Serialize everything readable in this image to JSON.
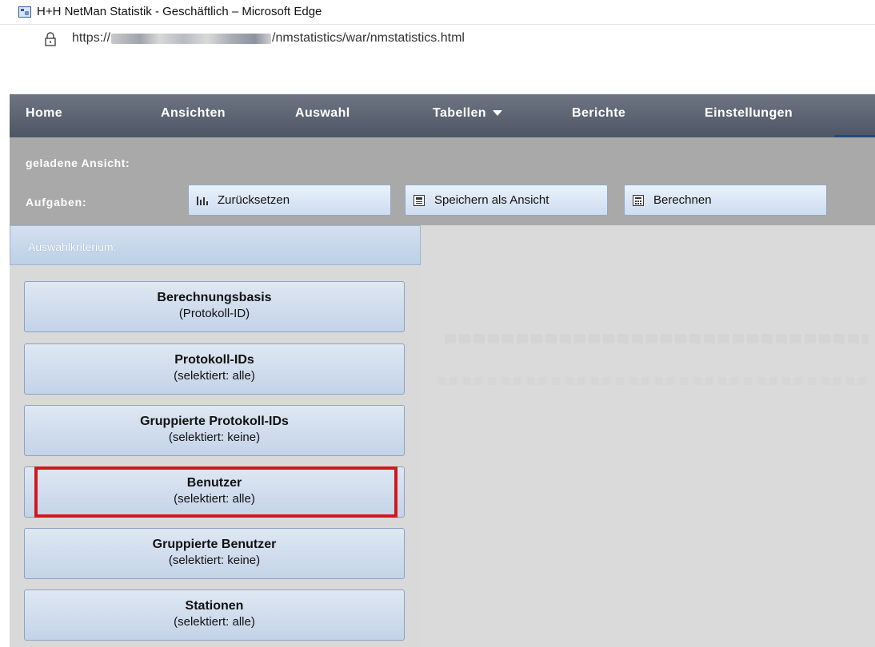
{
  "window": {
    "title": "H+H NetMan Statistik - Geschäftlich – Microsoft Edge",
    "url_prefix": "https://",
    "url_suffix": "/nmstatistics/war/nmstatistics.html"
  },
  "nav": {
    "items": [
      {
        "label": "Home"
      },
      {
        "label": "Ansichten"
      },
      {
        "label": "Auswahl"
      },
      {
        "label": "Tabellen"
      },
      {
        "label": "Berichte"
      },
      {
        "label": "Einstellungen"
      }
    ]
  },
  "toolbar": {
    "loaded_view_label": "geladene Ansicht:",
    "tasks_label": "Aufgaben:",
    "buttons": [
      {
        "label": "Zurücksetzen",
        "icon": "bar-chart-icon"
      },
      {
        "label": "Speichern als Ansicht",
        "icon": "save-icon"
      },
      {
        "label": "Berechnen",
        "icon": "calculator-icon"
      }
    ]
  },
  "panel": {
    "header": "Auswahlkriterium:",
    "criteria": [
      {
        "title": "Berechnungsbasis",
        "subtitle": "(Protokoll-ID)"
      },
      {
        "title": "Protokoll-IDs",
        "subtitle": "(selektiert: alle)"
      },
      {
        "title": "Gruppierte Protokoll-IDs",
        "subtitle": "(selektiert: keine)"
      },
      {
        "title": "Benutzer",
        "subtitle": "(selektiert: alle)",
        "highlighted": true
      },
      {
        "title": "Gruppierte Benutzer",
        "subtitle": "(selektiert: keine)"
      },
      {
        "title": "Stationen",
        "subtitle": "(selektiert: alle)"
      }
    ]
  },
  "colors": {
    "nav_bg": "#5a6272",
    "toolbar_bg": "#a9a9a9",
    "button_bg": "#cddcf0",
    "highlight": "#d1181f"
  }
}
